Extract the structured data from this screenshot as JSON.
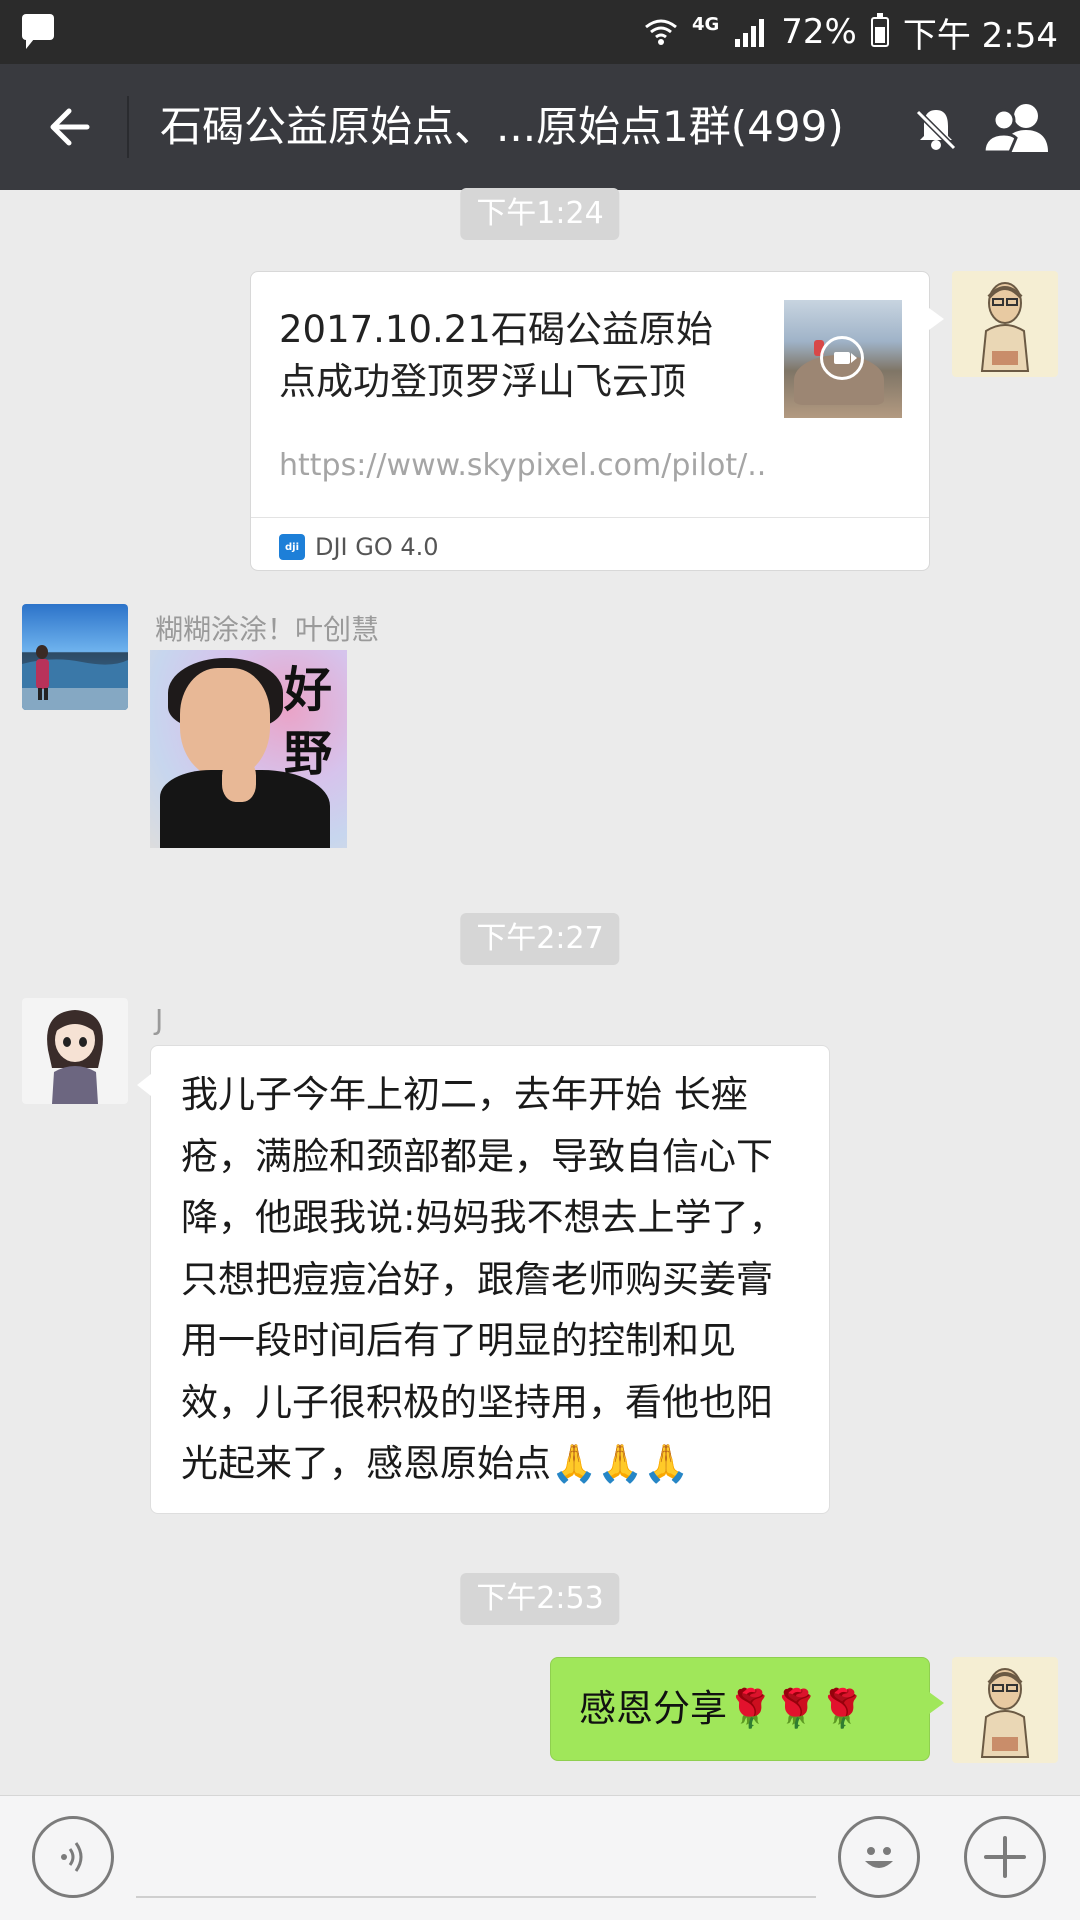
{
  "status_bar": {
    "network": "4G",
    "battery": "72%",
    "battery_level": 0.72,
    "time": "下午 2:54"
  },
  "header": {
    "title": "石碣公益原始点、...原始点1群(499)"
  },
  "messages": {
    "ts1": "下午1:24",
    "link_card": {
      "title": "2017.10.21石碣公益原始点成功登顶罗浮山飞云顶",
      "url": "https://www.skypixel.com/pilot/...",
      "source": "DJI GO 4.0",
      "source_icon_text": "dji"
    },
    "sticker": {
      "sender": "糊糊涂涂！叶创慧",
      "text": "好野"
    },
    "ts2": "下午2:27",
    "text_msg": {
      "sender": "J",
      "text": "我儿子今年上初二，去年开始 长痤疮，满脸和颈部都是，导致自信心下降，他跟我说:妈妈我不想去上学了，只想把痘痘冶好，跟詹老师购买姜膏用一段时间后有了明显的控制和见效，儿子很积极的坚持用，看他也阳光起来了，感恩原始点🙏🙏🙏"
    },
    "ts3": "下午2:53",
    "own_msg": {
      "text": "感恩分享🌹🌹🌹"
    }
  },
  "input": {
    "placeholder": ""
  },
  "colors": {
    "header_bg": "#393a3f",
    "chat_bg": "#ebebeb",
    "own_bubble": "#a0e75a",
    "timestamp_bg": "#d6d6d6"
  },
  "icons": {
    "back": "arrow-left-icon",
    "mute": "bell-off-icon",
    "members": "group-icon",
    "voice": "voice-icon",
    "emoji": "emoji-icon",
    "plus": "plus-icon"
  }
}
